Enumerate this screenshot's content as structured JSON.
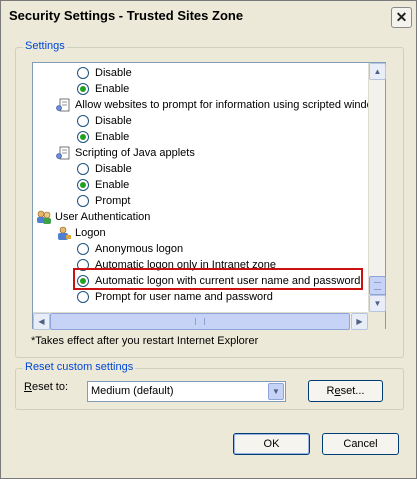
{
  "window": {
    "title": "Security Settings - Trusted Sites Zone",
    "close_glyph": "✕"
  },
  "settings": {
    "legend": "Settings",
    "rows": [
      {
        "type": "radio",
        "label": "Disable",
        "checked": false
      },
      {
        "type": "radio",
        "label": "Enable",
        "checked": true
      },
      {
        "type": "category",
        "label": "Allow websites to prompt for information using scripted windo",
        "icon": "settings-page-icon"
      },
      {
        "type": "radio",
        "label": "Disable",
        "checked": false
      },
      {
        "type": "radio",
        "label": "Enable",
        "checked": true
      },
      {
        "type": "category",
        "label": "Scripting of Java applets",
        "icon": "settings-page-icon"
      },
      {
        "type": "radio",
        "label": "Disable",
        "checked": false
      },
      {
        "type": "radio",
        "label": "Enable",
        "checked": true
      },
      {
        "type": "radio",
        "label": "Prompt",
        "checked": false
      },
      {
        "type": "category",
        "label": "User Authentication",
        "icon": "users-icon"
      },
      {
        "type": "category",
        "label": "Logon",
        "icon": "user-icon"
      },
      {
        "type": "radio",
        "label": "Anonymous logon",
        "checked": false
      },
      {
        "type": "radio",
        "label": "Automatic logon only in Intranet zone",
        "checked": false
      },
      {
        "type": "radio",
        "label": "Automatic logon with current user name and password",
        "checked": true
      },
      {
        "type": "radio",
        "label": "Prompt for user name and password",
        "checked": false
      }
    ],
    "highlight_color": "#cc1111",
    "note": "*Takes effect after you restart Internet Explorer"
  },
  "reset": {
    "legend": "Reset custom settings",
    "reset_to_prefix": "R",
    "reset_to_rest": "eset to:",
    "select_value": "Medium (default)",
    "button_prefix": "R",
    "button_underlined": "e",
    "button_rest": "set..."
  },
  "footer": {
    "ok_label": "OK",
    "cancel_label": "Cancel"
  },
  "colors": {
    "accent": "#0046d5",
    "radio_checked": "#21a121"
  }
}
